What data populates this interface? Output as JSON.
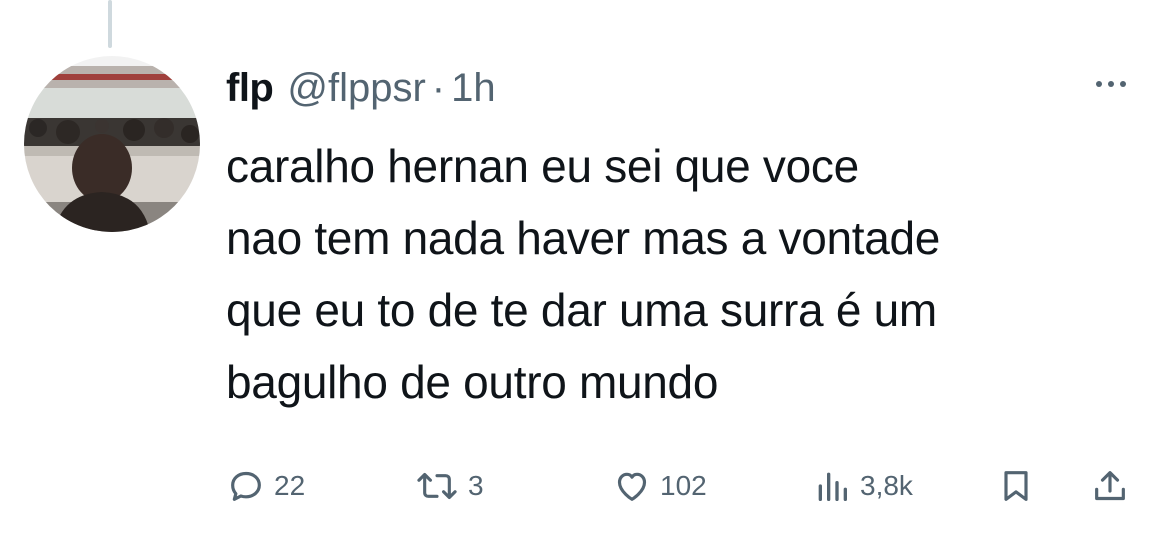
{
  "tweet": {
    "author_name": "flp",
    "handle": "@flppsr",
    "separator": "·",
    "time": "1h",
    "text": "caralho hernan eu sei que voce\nnao tem nada haver mas a vontade\nque eu to de te dar uma surra é um\nbagulho de outro mundo"
  },
  "actions": {
    "replies": "22",
    "retweets": "3",
    "likes": "102",
    "views": "3,8k"
  },
  "icons": {
    "reply": "reply-icon",
    "retweet": "retweet-icon",
    "like": "heart-icon",
    "views": "views-icon",
    "bookmark": "bookmark-icon",
    "share": "share-icon",
    "more": "more-icon"
  },
  "colors": {
    "text": "#0f1419",
    "secondary": "#536471",
    "thread_line": "#cfd9de"
  }
}
